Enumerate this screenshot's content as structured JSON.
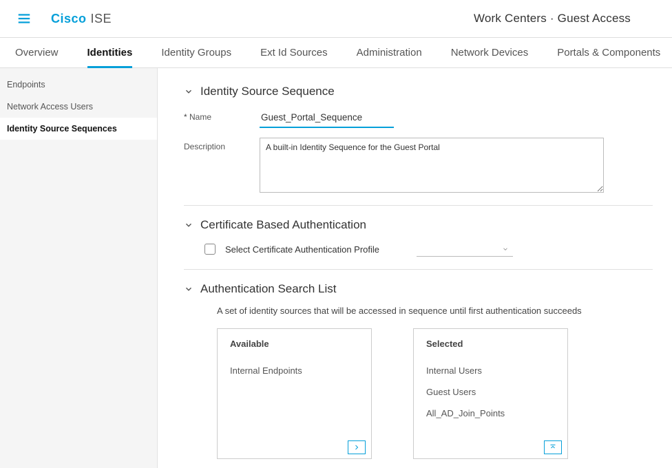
{
  "header": {
    "brand_bold": "Cisco",
    "brand_light": "ISE",
    "crumb": "Work Centers · Guest Access"
  },
  "tabs": [
    "Overview",
    "Identities",
    "Identity Groups",
    "Ext Id Sources",
    "Administration",
    "Network Devices",
    "Portals & Components"
  ],
  "tabs_active": 1,
  "sidebar": [
    "Endpoints",
    "Network Access Users",
    "Identity Source Sequences"
  ],
  "sidebar_active": 2,
  "section1": {
    "title": "Identity Source Sequence",
    "name_label": "Name",
    "name_value": "Guest_Portal_Sequence",
    "desc_label": "Description",
    "desc_value": "A built-in Identity Sequence for the Guest Portal"
  },
  "section2": {
    "title": "Certificate Based Authentication",
    "check_label": "Select Certificate Authentication Profile"
  },
  "section3": {
    "title": "Authentication Search List",
    "hint": "A set of identity sources that will be accessed in sequence until first authentication succeeds",
    "available_h": "Available",
    "available": [
      "Internal Endpoints"
    ],
    "selected_h": "Selected",
    "selected": [
      "Internal Users",
      "Guest Users",
      "All_AD_Join_Points"
    ]
  }
}
